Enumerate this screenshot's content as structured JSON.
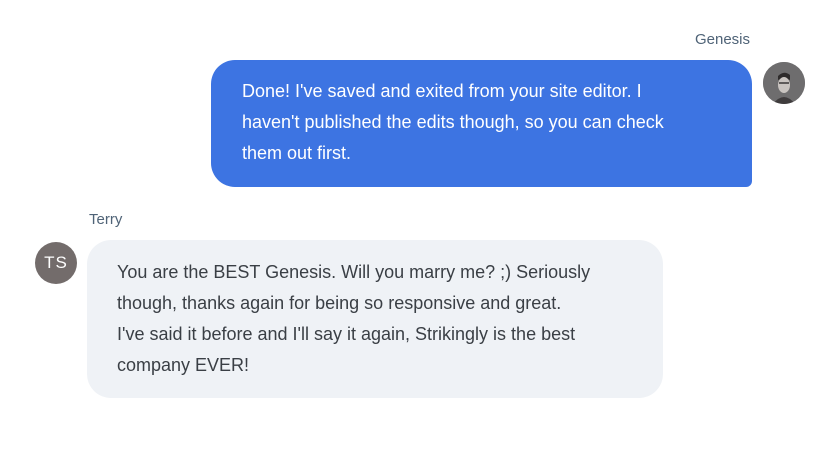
{
  "conversation": {
    "genesis": {
      "name": "Genesis",
      "message": "Done! I've saved and exited from your site editor. I\nhaven't published the edits though, so you can check\nthem out first.",
      "avatar_icon": "person-photo-icon"
    },
    "terry": {
      "name": "Terry",
      "initials": "TS",
      "message": "You are the BEST Genesis. Will you marry me? ;) Seriously\nthough, thanks again for being so responsive and great.\nI've said it before and I'll say it again, Strikingly is the best\ncompany EVER!"
    }
  },
  "colors": {
    "agent_bubble": "#3d74e2",
    "customer_bubble": "#eff2f6",
    "name_text": "#4f6377"
  }
}
